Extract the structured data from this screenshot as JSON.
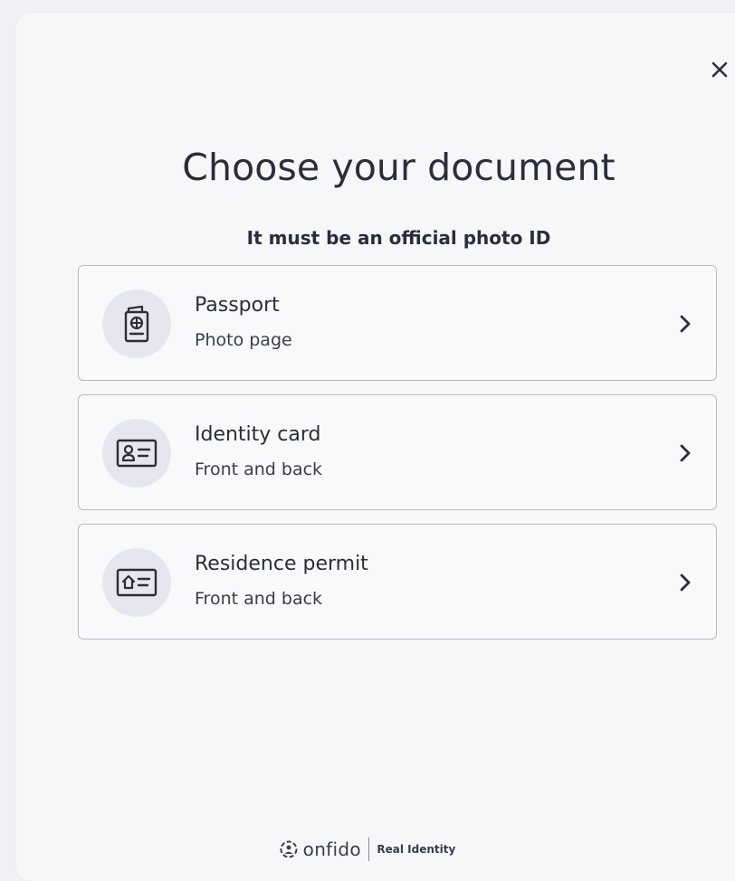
{
  "modal": {
    "close_label": "×",
    "title": "Choose your document",
    "subtitle": "It must be an official photo ID"
  },
  "options": [
    {
      "label": "Passport",
      "hint": "Photo page",
      "icon": "passport-icon"
    },
    {
      "label": "Identity card",
      "hint": "Front and back",
      "icon": "identity-card-icon"
    },
    {
      "label": "Residence permit",
      "hint": "Front and back",
      "icon": "residence-permit-icon"
    }
  ],
  "footer": {
    "brand": "onfido",
    "tagline": "Real Identity"
  },
  "colors": {
    "text": "#2b2d3b",
    "border": "#b8bac4",
    "icon_bg": "#e6e7ee",
    "background": "#f7f7f9"
  }
}
